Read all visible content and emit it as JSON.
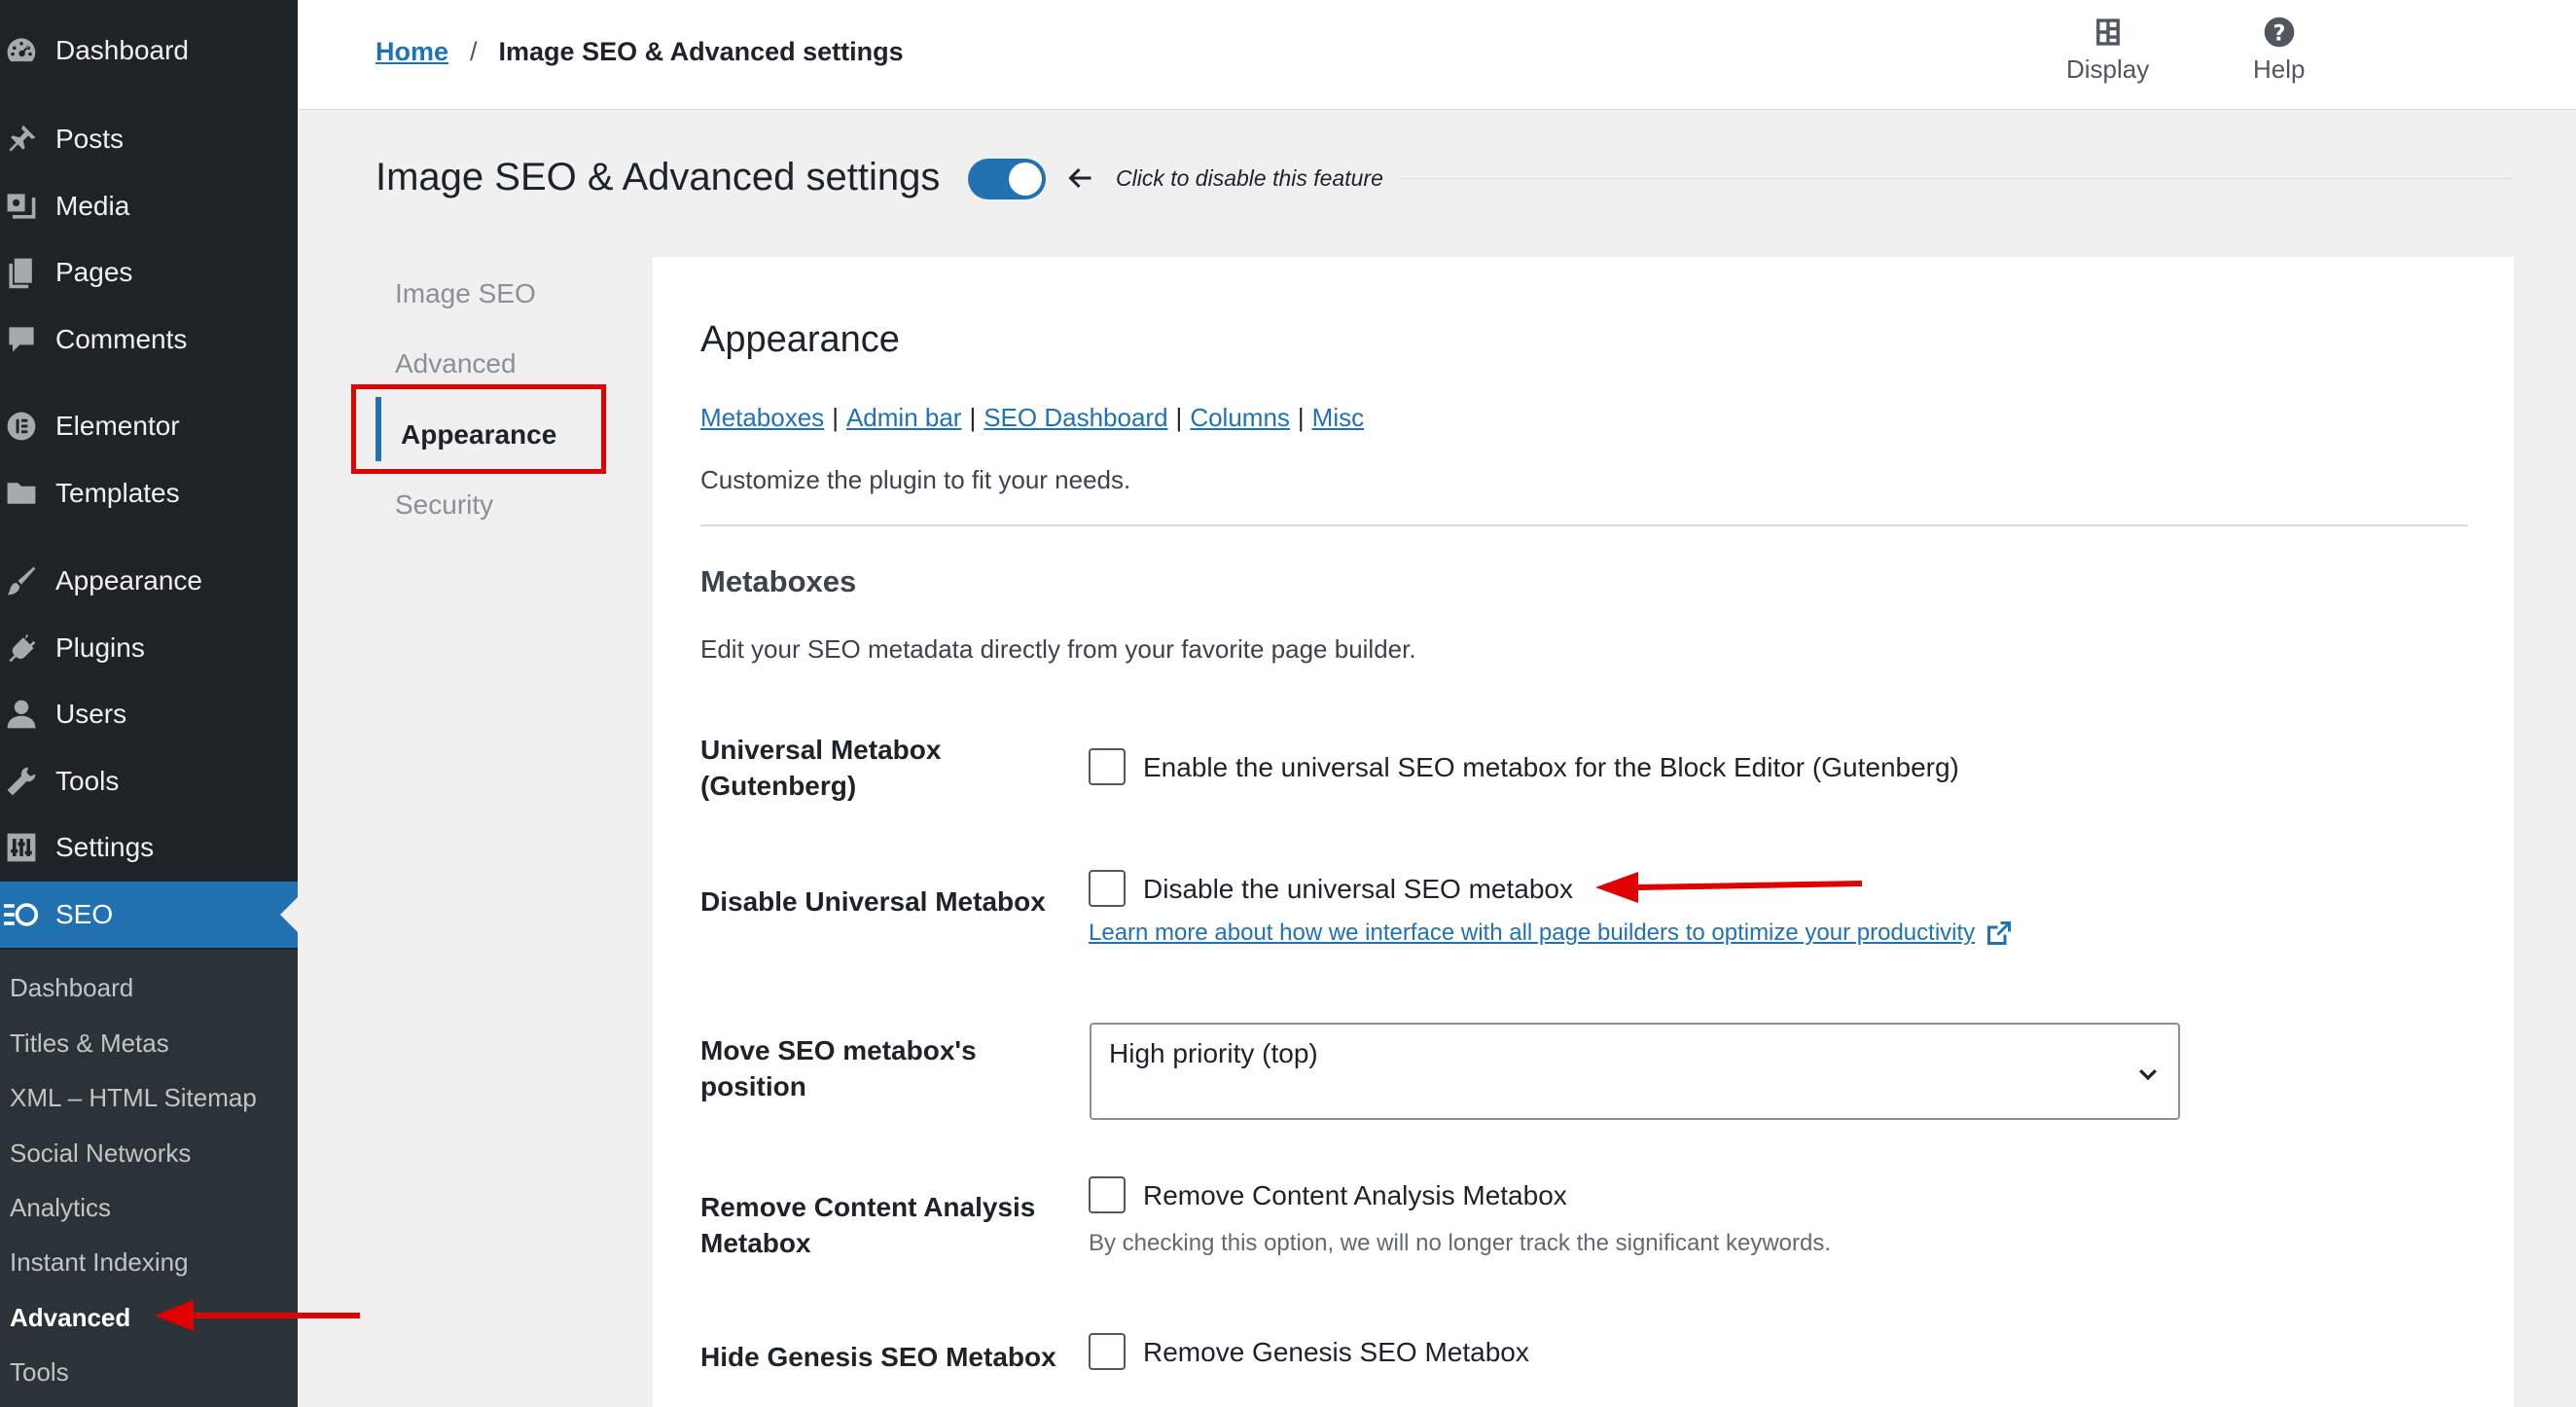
{
  "sidebar": {
    "items": [
      {
        "label": "Dashboard",
        "icon": "dashboard-icon"
      },
      {
        "label": "Posts",
        "icon": "pin-icon"
      },
      {
        "label": "Media",
        "icon": "media-icon"
      },
      {
        "label": "Pages",
        "icon": "pages-icon"
      },
      {
        "label": "Comments",
        "icon": "comment-icon"
      },
      {
        "label": "Elementor",
        "icon": "elementor-icon"
      },
      {
        "label": "Templates",
        "icon": "folder-icon"
      },
      {
        "label": "Appearance",
        "icon": "brush-icon"
      },
      {
        "label": "Plugins",
        "icon": "plug-icon"
      },
      {
        "label": "Users",
        "icon": "user-icon"
      },
      {
        "label": "Tools",
        "icon": "wrench-icon"
      },
      {
        "label": "Settings",
        "icon": "sliders-icon"
      },
      {
        "label": "SEO",
        "icon": "seo-icon"
      }
    ],
    "submenu": [
      "Dashboard",
      "Titles & Metas",
      "XML – HTML Sitemap",
      "Social Networks",
      "Analytics",
      "Instant Indexing",
      "Advanced",
      "Tools"
    ],
    "active_color": "#2271b1"
  },
  "header": {
    "breadcrumb_home": "Home",
    "breadcrumb_sep": "/",
    "breadcrumb_current": "Image SEO & Advanced settings",
    "display_label": "Display",
    "help_label": "Help"
  },
  "title_row": {
    "title": "Image SEO & Advanced settings",
    "toggle_hint": "Click to disable this feature"
  },
  "tabs": [
    "Image SEO",
    "Advanced",
    "Appearance",
    "Security"
  ],
  "panel": {
    "title": "Appearance",
    "links": [
      "Metaboxes",
      "Admin bar",
      "SEO Dashboard",
      "Columns",
      "Misc"
    ],
    "link_sep": "|",
    "description": "Customize the plugin to fit your needs.",
    "section_title": "Metaboxes",
    "section_desc": "Edit your SEO metadata directly from your favorite page builder.",
    "rows": {
      "universal": {
        "label_line1": "Universal Metabox",
        "label_line2": "(Gutenberg)",
        "checkbox_label": "Enable the universal SEO metabox for the Block Editor (Gutenberg)"
      },
      "disable": {
        "label": "Disable Universal Metabox",
        "checkbox_label": "Disable the universal SEO metabox",
        "help_link": "Learn more about how we interface with all page builders to optimize your productivity"
      },
      "position": {
        "label_line1": "Move SEO metabox's",
        "label_line2": "position",
        "selected": "High priority (top)"
      },
      "content_analysis": {
        "label_line1": "Remove Content Analysis",
        "label_line2": "Metabox",
        "checkbox_label": "Remove Content Analysis Metabox",
        "help_text": "By checking this option, we will no longer track the significant keywords."
      },
      "genesis": {
        "label": "Hide Genesis SEO Metabox",
        "checkbox_label": "Remove Genesis SEO Metabox"
      }
    }
  },
  "annotation_color": "#e00000"
}
